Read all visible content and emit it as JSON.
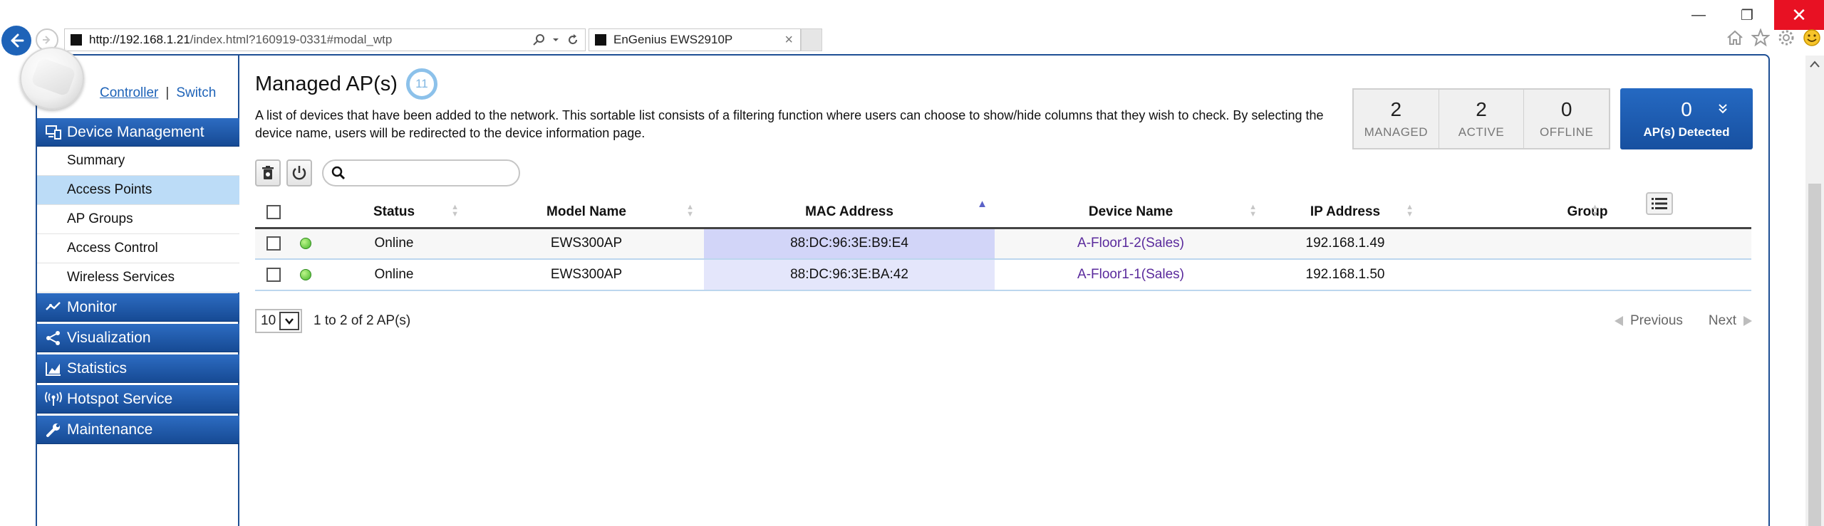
{
  "browser": {
    "url_host": "http://192.168.1.21",
    "url_path": "/index.html?160919-0331#modal_wtp",
    "tab_title": "EnGenius EWS2910P",
    "tab_close": "×",
    "minimize": "—",
    "restore": "❐",
    "close": "✕"
  },
  "sidebar": {
    "controller": "Controller",
    "separator": "|",
    "switch": "Switch",
    "sections": [
      {
        "label": "Device Management",
        "icon": "device-icon"
      },
      {
        "label": "Monitor",
        "icon": "monitor-icon"
      },
      {
        "label": "Visualization",
        "icon": "share-icon"
      },
      {
        "label": "Statistics",
        "icon": "chart-icon"
      },
      {
        "label": "Hotspot Service",
        "icon": "antenna-icon"
      },
      {
        "label": "Maintenance",
        "icon": "wrench-icon"
      }
    ],
    "device_items": [
      "Summary",
      "Access Points",
      "AP Groups",
      "Access Control",
      "Wireless Services"
    ],
    "selected_item": "Access Points"
  },
  "main": {
    "title": "Managed AP(s)",
    "count": "11",
    "description": "A list of devices that have been added to the network. This sortable list consists of a filtering function where users can choose to show/hide columns that they wish to check. By selecting the device name, users will be redirected to the device information page.",
    "stats": [
      {
        "value": "2",
        "label": "MANAGED"
      },
      {
        "value": "2",
        "label": "ACTIVE"
      },
      {
        "value": "0",
        "label": "OFFLINE"
      }
    ],
    "detected": {
      "value": "0",
      "label": "AP(s) Detected"
    },
    "search_placeholder": "",
    "columns": [
      "Status",
      "Model Name",
      "MAC Address",
      "Device Name",
      "IP Address",
      "Group"
    ],
    "rows": [
      {
        "status": "Online",
        "model": "EWS300AP",
        "mac": "88:DC:96:3E:B9:E4",
        "device": "A-Floor1-2(Sales)",
        "ip": "192.168.1.49",
        "group": ""
      },
      {
        "status": "Online",
        "model": "EWS300AP",
        "mac": "88:DC:96:3E:BA:42",
        "device": "A-Floor1-1(Sales)",
        "ip": "192.168.1.50",
        "group": ""
      }
    ],
    "pager": {
      "page_size": "10",
      "range_text": "1 to 2 of 2 AP(s)",
      "previous": "Previous",
      "next": "Next"
    }
  },
  "colors": {
    "menu_blue": "#1e4f94",
    "accent": "#1e63b8",
    "selected_item_bg": "#bcdcf7",
    "online_green": "#44b52a",
    "mac_highlight": "#d2d5f8",
    "close_red": "#e81123"
  }
}
